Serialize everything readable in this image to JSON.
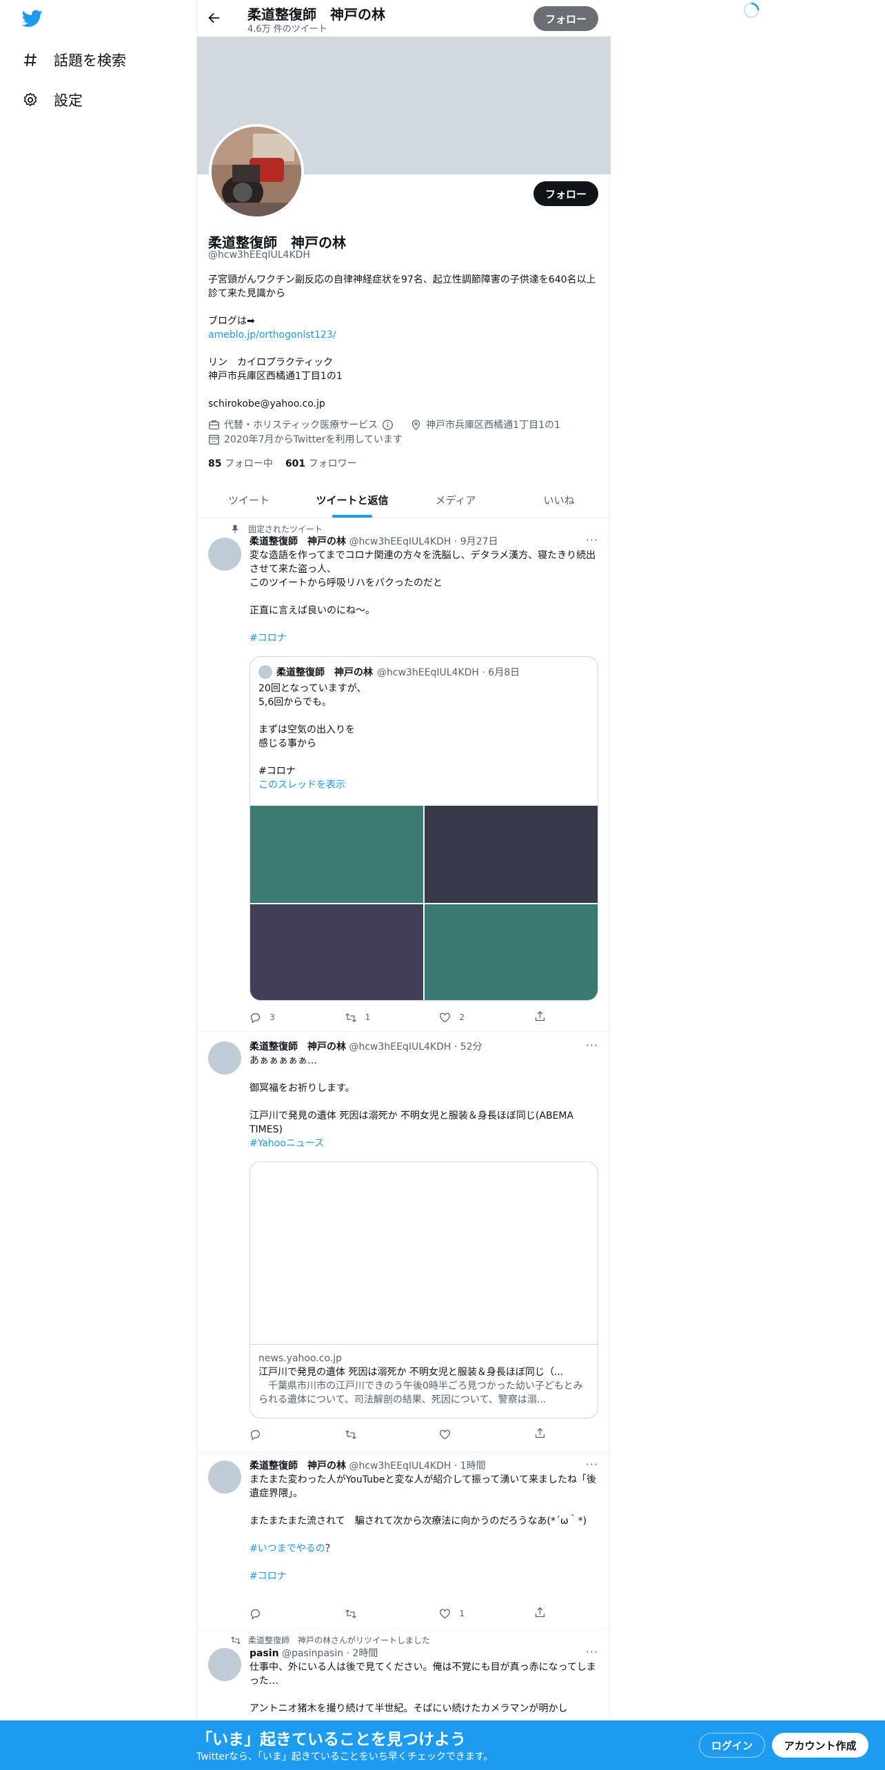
{
  "nav": {
    "explore_label": "話題を検索",
    "settings_label": "設定"
  },
  "header": {
    "title": "柔道整復師　神戸の林",
    "tweet_count": "4.6万 件のツイート",
    "follow_label": "フォロー"
  },
  "profile": {
    "name": "柔道整復師　神戸の林",
    "handle": "@hcw3hEEqIUL4KDH",
    "follow_label": "フォロー",
    "bio_line1": "子宮頸がんワクチン副反応の自律神経症状を97名、起立性調節障害の子供達を640名以上診て来た見識から",
    "bio_blog": "ブログは➡",
    "bio_link": "ameblo.jp/orthogonist123/",
    "bio_clinic": "リン　カイロプラクティック",
    "bio_address": "神戸市兵庫区西橘通1丁目1の1",
    "bio_email": "schirokobe@yahoo.co.jp",
    "category": "代替・ホリスティック医療サービス",
    "location": "神戸市兵庫区西橘通1丁目1の1",
    "joined": "2020年7月からTwitterを利用しています",
    "following_count": "85",
    "following_label": "フォロー中",
    "followers_count": "601",
    "followers_label": "フォロワー"
  },
  "tabs": [
    "ツイート",
    "ツイートと返信",
    "メディア",
    "いいね"
  ],
  "tweets": [
    {
      "pinned_label": "固定されたツイート",
      "name": "柔道整復師　神戸の林",
      "meta": "@hcw3hEEqIUL4KDH · 9月27日",
      "text1": "変な造語を作ってまでコロナ関連の方々を洗脳し、デタラメ漢方、寝たきり続出させて来た盗っ人、",
      "text2": "このツイートから呼吸リハをパクったのだと",
      "text3": "正直に言えば良いのにね〜。",
      "hashtag": "#コロナ",
      "quote": {
        "name": "柔道整復師　神戸の林",
        "meta": "@hcw3hEEqIUL4KDH · 6月8日",
        "line1": "20回となっていますが、",
        "line2": "5,6回からでも。",
        "line3": "まずは空気の出入りを",
        "line4": "感じる事から",
        "hashtag": "#コロナ",
        "thread_link": "このスレッドを表示",
        "image_colors": [
          "#3d7a72",
          "#363a4a",
          "#403f57",
          "#3b7a74"
        ]
      },
      "replies": "3",
      "retweets": "1",
      "likes": "2"
    },
    {
      "name": "柔道整復師　神戸の林",
      "meta": "@hcw3hEEqIUL4KDH · 52分",
      "text1": "あぁぁぁぁぁ…",
      "text2": "御冥福をお祈りします。",
      "text3": "江戸川で発見の遺体 死因は溺死か 不明女児と服装＆身長ほぼ同じ(ABEMA TIMES)",
      "hashtag": "#Yahooニュース",
      "card_domain": "news.yahoo.co.jp",
      "card_title": "江戸川で発見の遺体 死因は溺死か 不明女児と服装＆身長ほぼ同じ（...",
      "card_desc": "　千葉県市川市の江戸川できのう午後0時半ごろ見つかった幼い子どもとみられる遺体について、司法解剖の結果、死因について、警察は溺..."
    },
    {
      "name": "柔道整復師　神戸の林",
      "meta": "@hcw3hEEqIUL4KDH · 1時間",
      "text1": "またまた変わった人がYouTubeと変な人が紹介して振って湧いて来ましたね「後遺症界隈」。",
      "text2": "またまたまた流されて　騙されて次から次療法に向かうのだろうなあ(*´ω｀*)",
      "hashtag1": "#いつまでやるの",
      "hashtag1_suffix": "？",
      "hashtag2": "#コロナ",
      "likes": "1"
    },
    {
      "retweet_label": "柔道整復師　神戸の林さんがリツイートしました",
      "name": "pasin",
      "meta": "@pasinpasin · 2時間",
      "text1": "仕事中、外にいる人は後で見てください。俺は不覚にも目が真っ赤になってしまった…",
      "text2": "アントニオ猪木を撮り続けて半世紀。そばにい続けたカメラマンが明かし"
    }
  ],
  "bottom_bar": {
    "title": "「いま」起きていることを見つけよう",
    "subtitle": "Twitterなら、「いま」起きていることをいち早くチェックできます。",
    "login_label": "ログイン",
    "signup_label": "アカウント作成"
  },
  "colors": {
    "accent": "#1d9bf0",
    "dark": "#0f1419",
    "muted": "#536471",
    "banner": "#cfd9de"
  }
}
